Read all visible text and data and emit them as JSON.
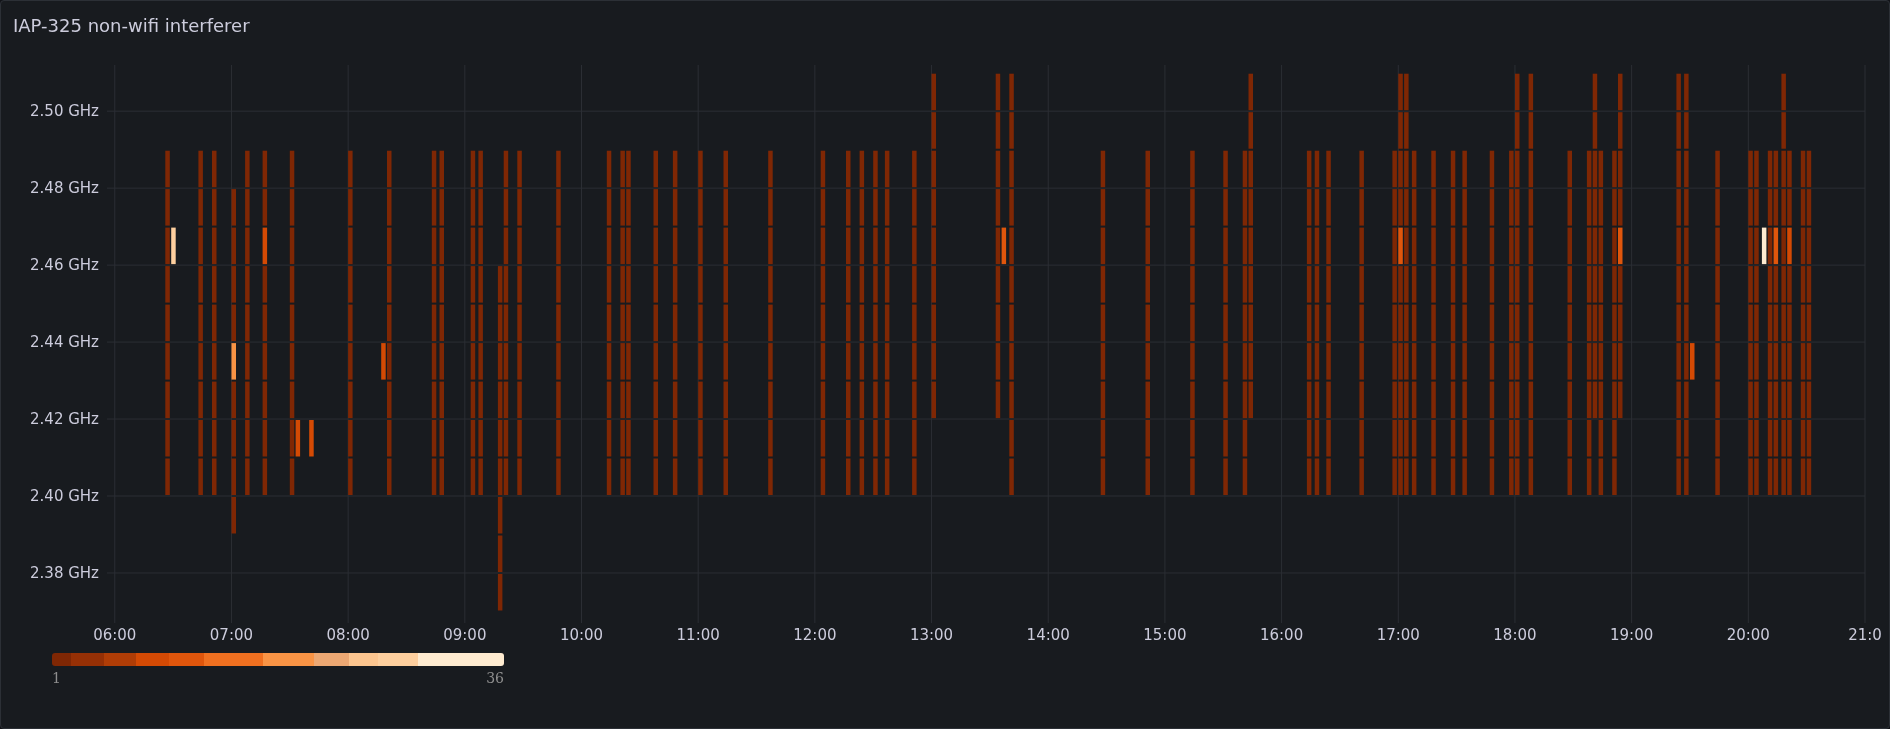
{
  "panel": {
    "title": "IAP-325 non-wifi interferer"
  },
  "y_axis": {
    "labels": [
      "2.50 GHz",
      "2.48 GHz",
      "2.46 GHz",
      "2.44 GHz",
      "2.42 GHz",
      "2.40 GHz",
      "2.38 GHz"
    ]
  },
  "x_axis": {
    "labels": [
      "06:00",
      "07:00",
      "08:00",
      "09:00",
      "10:00",
      "11:00",
      "12:00",
      "13:00",
      "14:00",
      "15:00",
      "16:00",
      "17:00",
      "18:00",
      "19:00",
      "20:00",
      "21:0"
    ]
  },
  "legend": {
    "min": "1",
    "max": "36"
  }
}
